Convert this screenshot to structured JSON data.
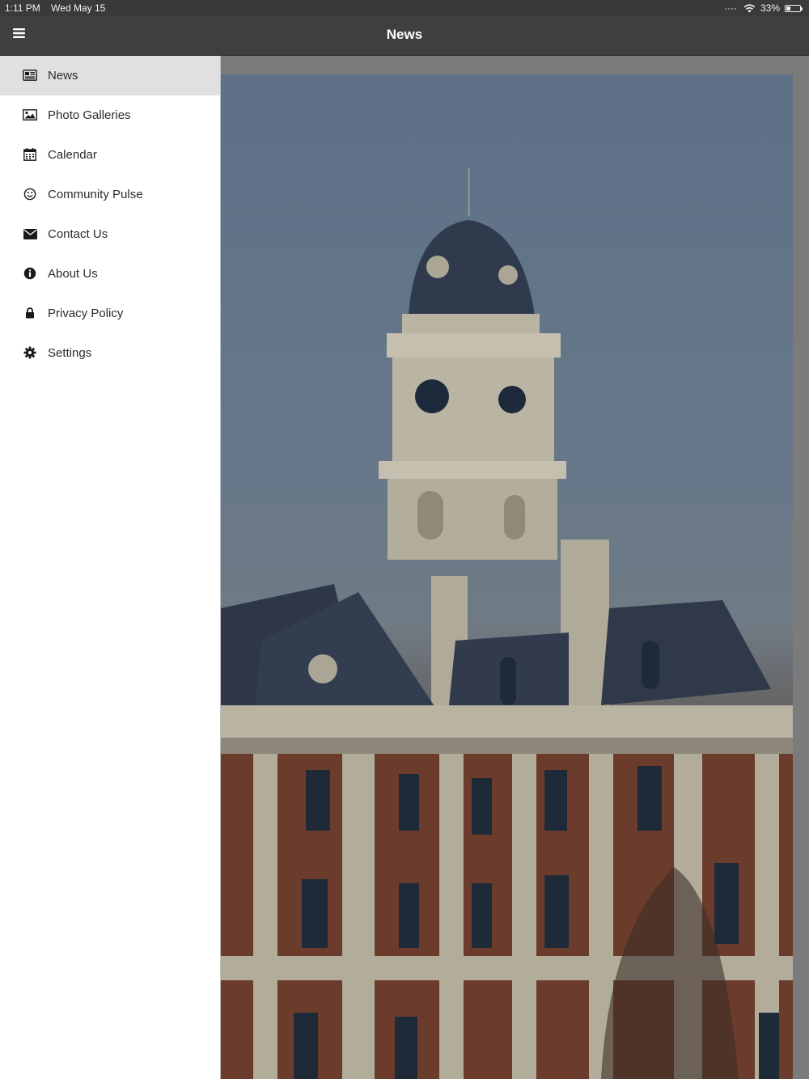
{
  "status_bar": {
    "time": "1:11 PM",
    "date": "Wed May 15",
    "battery_percent": "33%",
    "battery_level": 0.33
  },
  "nav_bar": {
    "title": "News",
    "menu_icon": "hamburger-icon"
  },
  "drawer": {
    "items": [
      {
        "label": "News",
        "icon": "newspaper-icon",
        "active": true
      },
      {
        "label": "Photo Galleries",
        "icon": "image-icon",
        "active": false
      },
      {
        "label": "Calendar",
        "icon": "calendar-icon",
        "active": false
      },
      {
        "label": "Community Pulse",
        "icon": "smiley-icon",
        "active": false
      },
      {
        "label": "Contact Us",
        "icon": "envelope-icon",
        "active": false
      },
      {
        "label": "About Us",
        "icon": "info-icon",
        "active": false
      },
      {
        "label": "Privacy Policy",
        "icon": "lock-icon",
        "active": false
      },
      {
        "label": "Settings",
        "icon": "gear-icon",
        "active": false
      }
    ]
  },
  "colors": {
    "nav_background": "#3f3f3f",
    "active_item_background": "#e0e0e0",
    "drawer_background": "#ffffff",
    "overlay": "#7b7b7b"
  }
}
